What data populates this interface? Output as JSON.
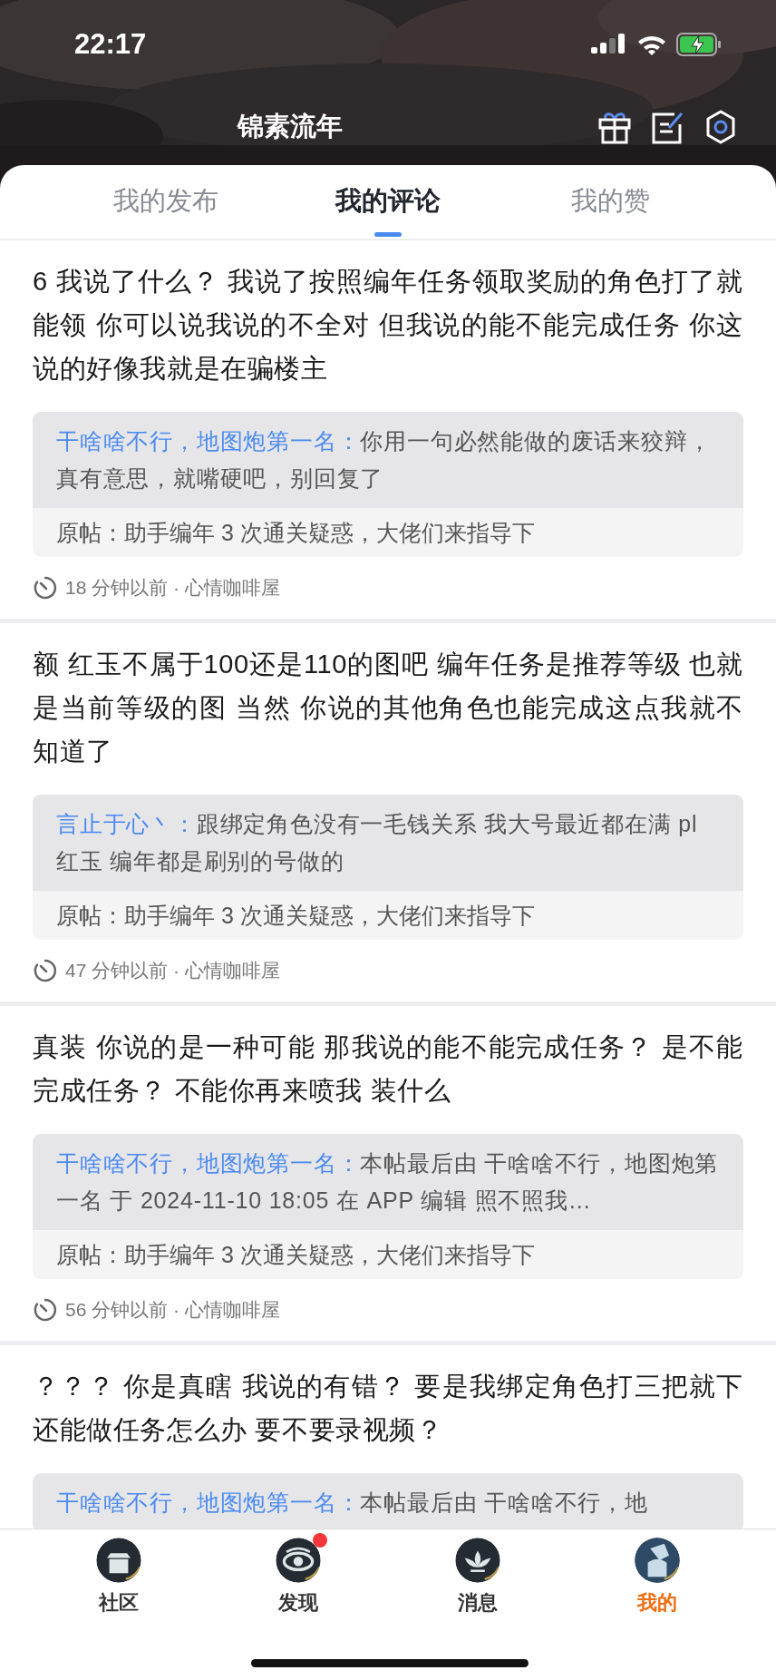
{
  "status_bar": {
    "time": "22:17"
  },
  "header": {
    "title": "锦素流年"
  },
  "tabs": [
    {
      "label": "我的发布",
      "selected": false
    },
    {
      "label": "我的评论",
      "selected": true
    },
    {
      "label": "我的赞",
      "selected": false
    }
  ],
  "comments": [
    {
      "text": "6 我说了什么？ 我说了按照编年任务领取奖励的角色打了就能领  你可以说我说的不全对  但我说的能不能完成任务  你这说的好像我就是在骗楼主",
      "reply_author": "干啥啥不行，地图炮第一名：",
      "reply_text": "你用一句必然能做的废话来狡辩，真有意思，就嘴硬吧，别回复了",
      "original_post": "原帖：助手编年 3 次通关疑惑，大佬们来指导下",
      "meta": "18 分钟以前 · 心情咖啡屋"
    },
    {
      "text": "额 红玉不属于100还是110的图吧 编年任务是推荐等级 也就是当前等级的图  当然  你说的其他角色也能完成这点我就不知道了",
      "reply_author": "言止于心丶：",
      "reply_text": "跟绑定角色没有一毛钱关系 我大号最近都在满 pl 红玉 编年都是刷别的号做的",
      "original_post": "原帖：助手编年 3 次通关疑惑，大佬们来指导下",
      "meta": "47 分钟以前 · 心情咖啡屋"
    },
    {
      "text": "真装 你说的是一种可能 那我说的能不能完成任务？  是不能完成任务？  不能你再来喷我 装什么",
      "reply_author": "干啥啥不行，地图炮第一名：",
      "reply_text": "本帖最后由 干啥啥不行，地图炮第一名 于 2024-11-10 18:05 在 APP 编辑 照不照我…",
      "original_post": "原帖：助手编年 3 次通关疑惑，大佬们来指导下",
      "meta": "56 分钟以前 · 心情咖啡屋"
    },
    {
      "text": "？？？  你是真瞎  我说的有错？  要是我绑定角色打三把就下还能做任务怎么办 要不要录视频？",
      "reply_author": "干啥啥不行，地图炮第一名：",
      "reply_text": "本帖最后由 干啥啥不行，地"
    }
  ],
  "bottom_nav": [
    {
      "label": "社区",
      "kind": "hall",
      "selected": false,
      "badge": false
    },
    {
      "label": "发现",
      "kind": "eye",
      "selected": false,
      "badge": true
    },
    {
      "label": "消息",
      "kind": "lotus",
      "selected": false,
      "badge": false
    },
    {
      "label": "我的",
      "kind": "avatar",
      "selected": true,
      "badge": false
    }
  ]
}
